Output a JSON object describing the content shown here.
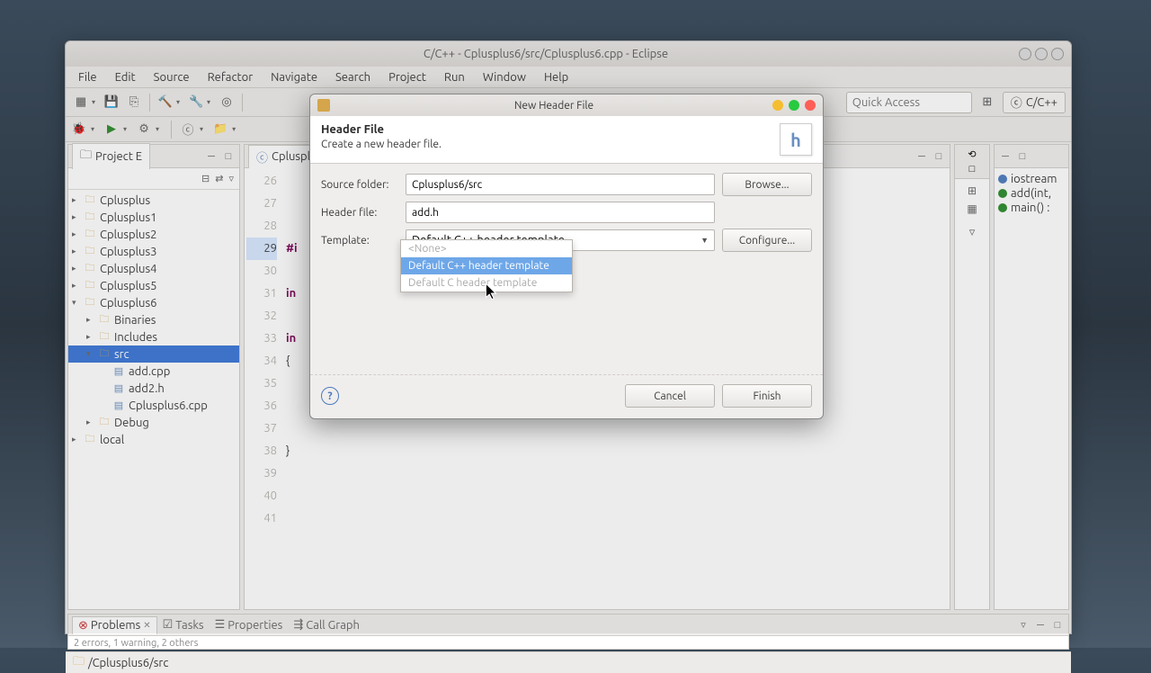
{
  "main_window": {
    "title": "C/C++ - Cplusplus6/src/Cplusplus6.cpp - Eclipse",
    "menus": [
      "File",
      "Edit",
      "Source",
      "Refactor",
      "Navigate",
      "Search",
      "Project",
      "Run",
      "Window",
      "Help"
    ],
    "quick_access_placeholder": "Quick Access",
    "perspective": "C/C++"
  },
  "project_explorer": {
    "title": "Project E",
    "items": [
      {
        "label": "Cplusplus",
        "depth": 0,
        "expanded": false,
        "type": "project"
      },
      {
        "label": "Cplusplus1",
        "depth": 0,
        "expanded": false,
        "type": "project"
      },
      {
        "label": "Cplusplus2",
        "depth": 0,
        "expanded": false,
        "type": "project"
      },
      {
        "label": "Cplusplus3",
        "depth": 0,
        "expanded": false,
        "type": "project"
      },
      {
        "label": "Cplusplus4",
        "depth": 0,
        "expanded": false,
        "type": "project"
      },
      {
        "label": "Cplusplus5",
        "depth": 0,
        "expanded": false,
        "type": "project"
      },
      {
        "label": "Cplusplus6",
        "depth": 0,
        "expanded": true,
        "type": "project"
      },
      {
        "label": "Binaries",
        "depth": 1,
        "expanded": false,
        "type": "binaries"
      },
      {
        "label": "Includes",
        "depth": 1,
        "expanded": false,
        "type": "includes"
      },
      {
        "label": "src",
        "depth": 1,
        "expanded": true,
        "type": "folder",
        "selected": true
      },
      {
        "label": "add.cpp",
        "depth": 2,
        "expanded": false,
        "type": "file"
      },
      {
        "label": "add2.h",
        "depth": 2,
        "expanded": false,
        "type": "file"
      },
      {
        "label": "Cplusplus6.cpp",
        "depth": 2,
        "expanded": false,
        "type": "file"
      },
      {
        "label": "Debug",
        "depth": 1,
        "expanded": false,
        "type": "folder"
      },
      {
        "label": "local",
        "depth": 0,
        "expanded": false,
        "type": "folder"
      }
    ]
  },
  "editor": {
    "tab": "Cplusplus",
    "lines": [
      "26",
      "27",
      "28",
      "29",
      "30",
      "31",
      "32",
      "33",
      "34",
      "35",
      "36",
      "37",
      "38",
      "39",
      "40",
      "41"
    ],
    "highlighted_line": "29",
    "code_snippets": {
      "l29": "#i",
      "l31": "in",
      "l33": "in",
      "l34": "{",
      "l38": "}"
    }
  },
  "outline": {
    "items": [
      {
        "label": "iostream",
        "kind": "include"
      },
      {
        "label": "add(int,",
        "kind": "func"
      },
      {
        "label": "main() :",
        "kind": "func"
      }
    ]
  },
  "bottom": {
    "tabs": [
      "Problems",
      "Tasks",
      "Properties",
      "Call Graph"
    ],
    "active": 0,
    "status": "2 errors, 1 warning, 2 others"
  },
  "statusbar": {
    "path": "/Cplusplus6/src"
  },
  "dialog": {
    "title": "New Header File",
    "heading": "Header File",
    "subheading": "Create a new header file.",
    "source_folder_label": "Source folder:",
    "source_folder_value": "Cplusplus6/src",
    "browse": "Browse...",
    "header_file_label": "Header file:",
    "header_file_value": "add.h",
    "template_label": "Template:",
    "template_value": "Default C++ header template",
    "configure": "Configure...",
    "dropdown_items": [
      "<None>",
      "Default C++ header template",
      "Default C header template"
    ],
    "dropdown_highlighted": 1,
    "cancel": "Cancel",
    "finish": "Finish"
  }
}
